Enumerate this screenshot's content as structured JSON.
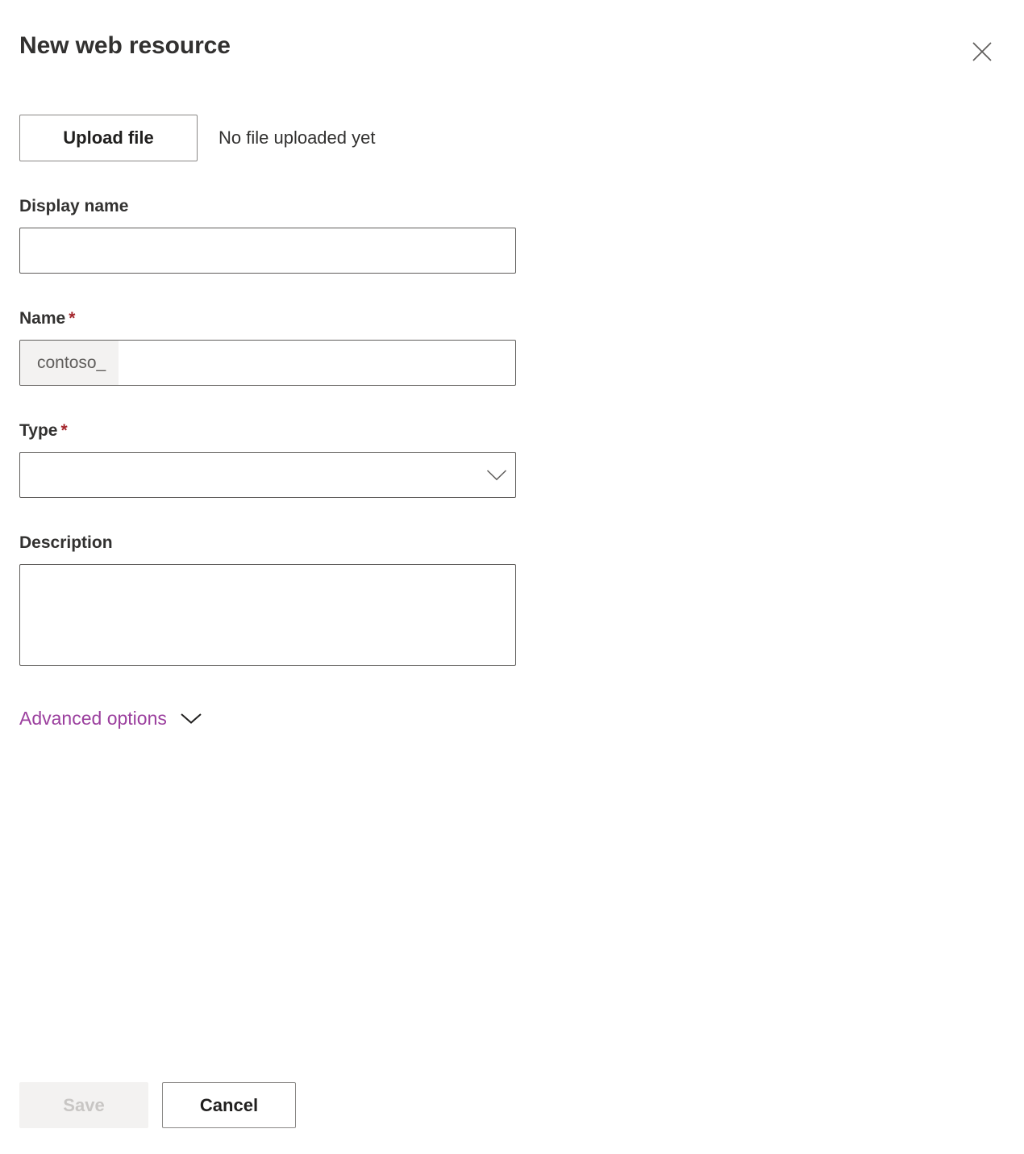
{
  "header": {
    "title": "New web resource",
    "close_icon": "close-icon",
    "close_label": "Close"
  },
  "upload": {
    "button_label": "Upload file",
    "status_text": "No file uploaded yet"
  },
  "fields": {
    "display_name": {
      "label": "Display name",
      "value": "",
      "placeholder": "",
      "required": false
    },
    "name": {
      "label": "Name",
      "required_marker": "*",
      "prefix": "contoso_",
      "value": "",
      "placeholder": "",
      "required": true
    },
    "type": {
      "label": "Type",
      "required_marker": "*",
      "value": "",
      "chevron_icon": "chevron-down-icon",
      "required": true
    },
    "description": {
      "label": "Description",
      "value": "",
      "placeholder": "",
      "required": false
    }
  },
  "advanced_options": {
    "label": "Advanced options",
    "chevron_icon": "chevron-down-icon",
    "expanded": false
  },
  "footer": {
    "save_label": "Save",
    "save_disabled": true,
    "cancel_label": "Cancel"
  },
  "colors": {
    "accent_purple": "#9b3f9e",
    "required_red": "#a4262c",
    "text_primary": "#323130",
    "border": "#605e5c",
    "button_border": "#8a8886",
    "disabled_bg": "#f3f2f1",
    "disabled_text": "#c8c6c4",
    "prefix_bg": "#f3f2f1"
  }
}
